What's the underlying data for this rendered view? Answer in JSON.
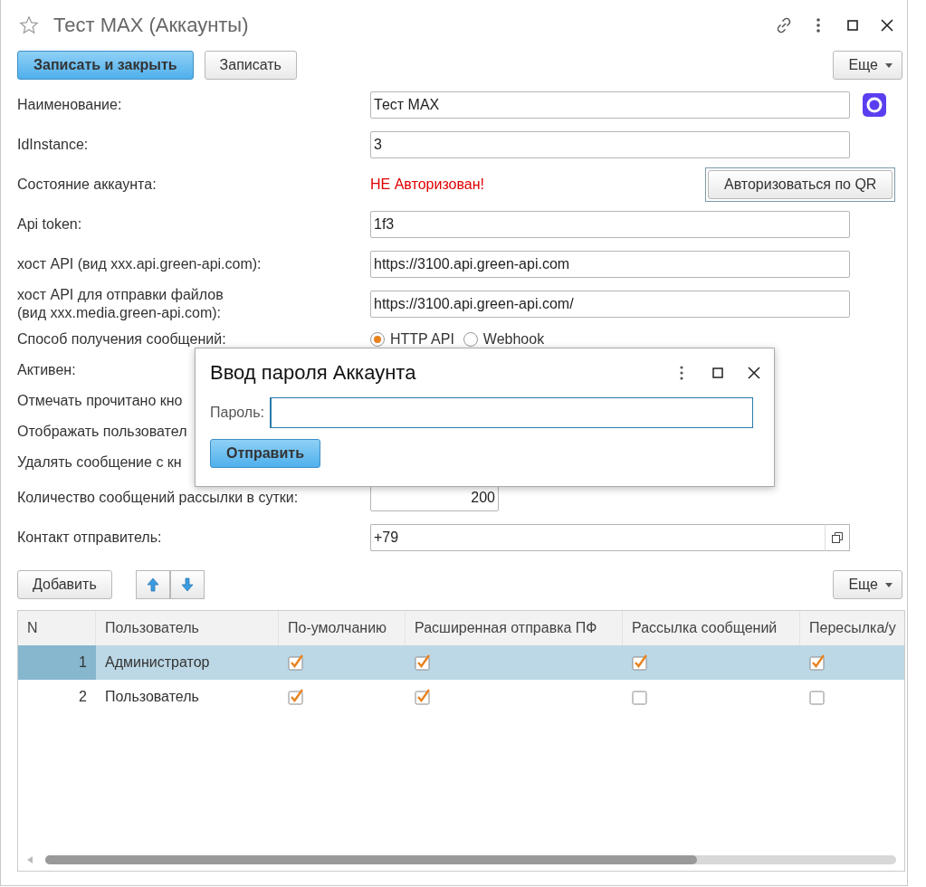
{
  "window": {
    "title": "Тест MAX (Аккаунты)",
    "favorite": false
  },
  "toolbar": {
    "buttons": [
      {
        "label": "Записать и закрыть",
        "default": true
      },
      {
        "label": "Записать",
        "default": false
      }
    ],
    "more": "Еще"
  },
  "fields": [
    {
      "kind": "text",
      "label": "Наименование:",
      "value": "Тест MAX",
      "logo": true
    },
    {
      "kind": "text",
      "label": "IdInstance:",
      "value": "3"
    },
    {
      "kind": "status",
      "label": "Состояние аккаунта:",
      "value": "НЕ Авторизован!",
      "button": "Авторизоваться по QR"
    },
    {
      "kind": "text",
      "label": "Api token:",
      "value": "1f3"
    },
    {
      "kind": "text",
      "label": "хост API (вид xxx.api.green-api.com):",
      "value": "https://3100.api.green-api.com"
    },
    {
      "kind": "text",
      "label": "хост API для отправки файлов\n(вид xxx.media.green-api.com):",
      "value": "https://3100.api.green-api.com/"
    },
    {
      "kind": "radio",
      "label": "Способ получения сообщений:",
      "options": [
        {
          "label": "HTTP API",
          "selected": true
        },
        {
          "label": "Webhook",
          "selected": false
        }
      ]
    },
    {
      "kind": "label",
      "label": "Активен:"
    },
    {
      "kind": "label",
      "label": "Отмечать прочитано кно"
    },
    {
      "kind": "label",
      "label": "Отображать пользовател"
    },
    {
      "kind": "label",
      "label": "Удалять сообщение с кн"
    },
    {
      "kind": "number",
      "label": "Количество сообщений рассылки в сутки:",
      "value": "200"
    },
    {
      "kind": "contact",
      "label": "Контакт отправитель:",
      "value": "+79"
    }
  ],
  "table_toolbar": {
    "add": "Добавить",
    "more": "Еще"
  },
  "table": {
    "columns": [
      "N",
      "Пользователь",
      "По-умолчанию",
      "Расширенная отправка ПФ",
      "Рассылка сообщений",
      "Пересылка/у"
    ],
    "rows": [
      {
        "n": "1",
        "user": "Администратор",
        "selected": true,
        "flags": [
          true,
          true,
          true,
          true
        ]
      },
      {
        "n": "2",
        "user": "Пользователь",
        "selected": false,
        "flags": [
          true,
          true,
          false,
          false
        ]
      }
    ]
  },
  "dialog": {
    "title": "Ввод пароля Аккаунта",
    "field_label": "Пароль:",
    "focused": true,
    "button": "Отправить"
  }
}
